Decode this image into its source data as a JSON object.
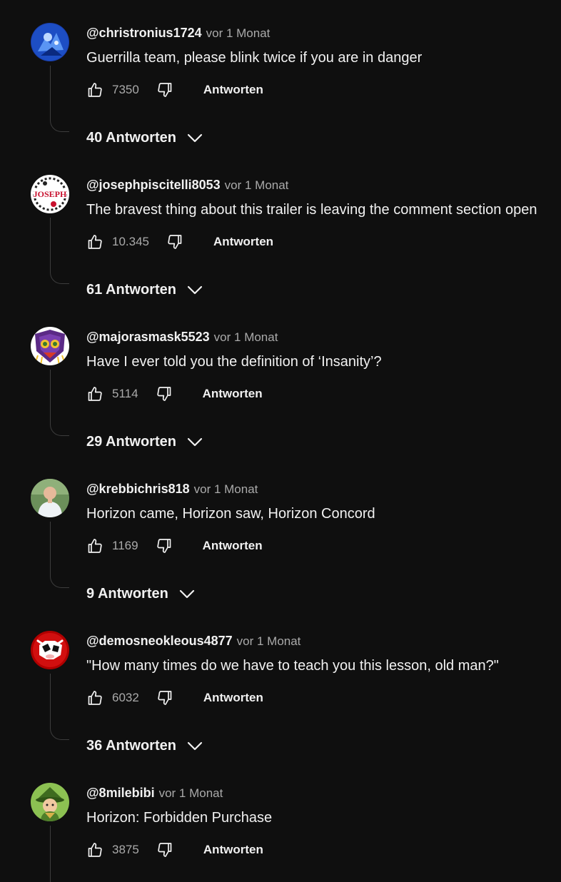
{
  "comments": [
    {
      "handle": "@christronius1724",
      "time": "vor 1 Monat",
      "text": "Guerrilla team, please blink twice if you are in danger",
      "likes": "7350",
      "reply_label": "Antworten",
      "replies_label": "40 Antworten",
      "avatar_icon": "blue-robot-avatar"
    },
    {
      "handle": "@josephpiscitelli8053",
      "time": "vor 1 Monat",
      "text": "The bravest thing about this trailer is leaving the comment section open",
      "likes": "10.345",
      "reply_label": "Antworten",
      "replies_label": "61 Antworten",
      "avatar_icon": "joseph-logo-avatar"
    },
    {
      "handle": "@majorasmask5523",
      "time": "vor 1 Monat",
      "text": "Have I ever told you the definition of ‘Insanity’?",
      "likes": "5114",
      "reply_label": "Antworten",
      "replies_label": "29 Antworten",
      "avatar_icon": "majoras-mask-avatar"
    },
    {
      "handle": "@krebbichris818",
      "time": "vor 1 Monat",
      "text": "Horizon came, Horizon saw, Horizon Concord",
      "likes": "1169",
      "reply_label": "Antworten",
      "replies_label": "9 Antworten",
      "avatar_icon": "person-photo-avatar"
    },
    {
      "handle": "@demosneokleous4877",
      "time": "vor 1 Monat",
      "text": "\"How many times do we have to teach you this lesson, old man?\"",
      "likes": "6032",
      "reply_label": "Antworten",
      "replies_label": "36 Antworten",
      "avatar_icon": "red-cow-avatar"
    },
    {
      "handle": "@8milebibi",
      "time": "vor 1 Monat",
      "text": "Horizon: Forbidden Purchase",
      "likes": "3875",
      "reply_label": "Antworten",
      "replies_label": "",
      "avatar_icon": "green-character-avatar"
    }
  ],
  "icons": {
    "like": "thumbs-up-icon",
    "dislike": "thumbs-down-icon",
    "expand": "chevron-down-icon"
  },
  "colors": {
    "background": "#0f0f0f",
    "text_primary": "#f1f1f1",
    "text_secondary": "#aaaaaa",
    "thread_line": "#3d3d3d"
  }
}
